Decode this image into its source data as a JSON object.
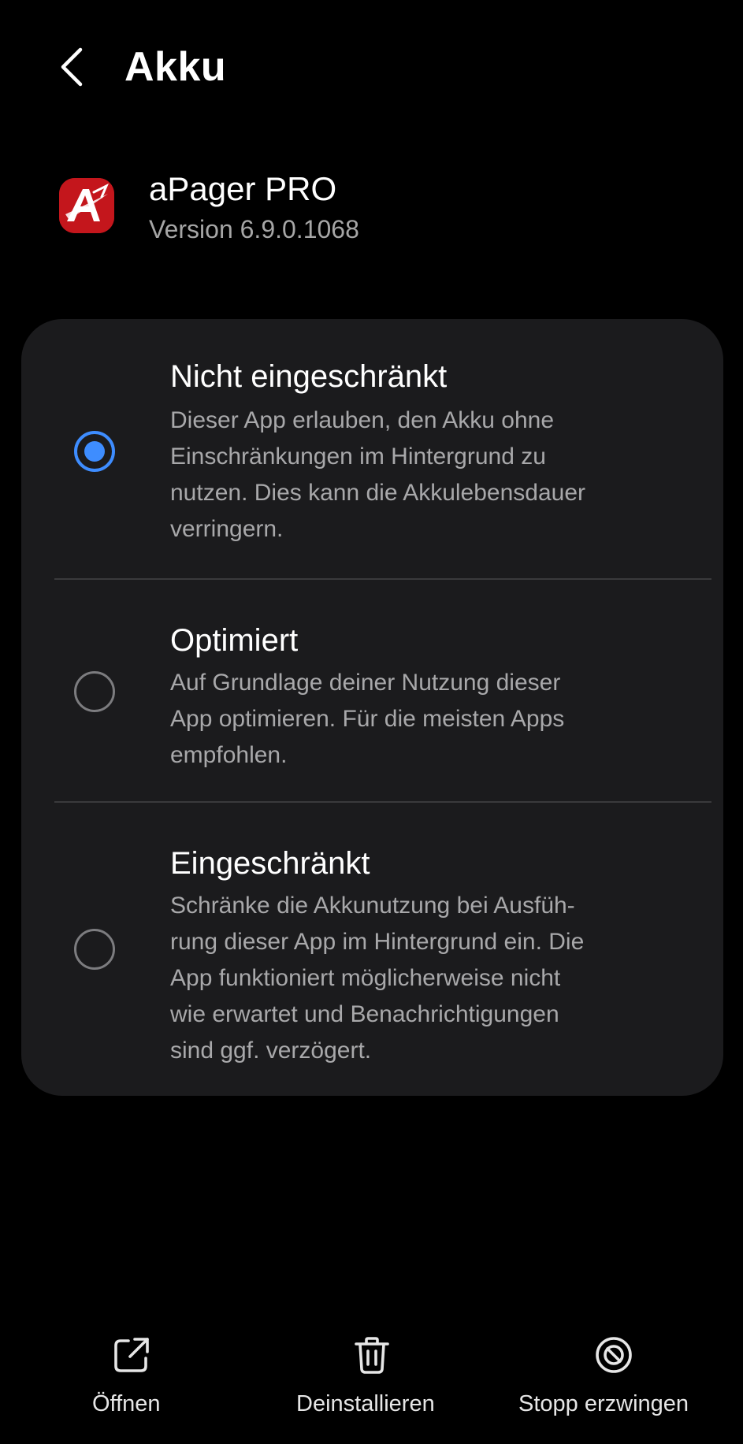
{
  "header": {
    "title": "Akku",
    "back_icon": "chevron-left-icon"
  },
  "app": {
    "name": "aPager PRO",
    "version": "Version 6.9.0.1068",
    "icon_color": "#c4161c"
  },
  "options": [
    {
      "title": "Nicht eingeschränkt",
      "desc_lines": [
        "Dieser App erlauben, den Akku ohne",
        "Einschränkungen im Hintergrund zu",
        "nutzen. Dies kann die Akkulebensdauer",
        "verringern."
      ],
      "selected": true
    },
    {
      "title": "Optimiert",
      "desc_lines": [
        "Auf Grundlage deiner Nutzung dieser",
        "App optimieren. Für die meisten Apps",
        "empfohlen."
      ],
      "selected": false
    },
    {
      "title": "Eingeschränkt",
      "desc_lines": [
        "Schränke die Akkunutzung bei Ausfüh-",
        "rung dieser App im Hintergrund ein. Die",
        "App funktioniert möglicherweise nicht",
        "wie erwartet und Benachrichtigungen",
        "sind ggf. verzögert."
      ],
      "selected": false
    }
  ],
  "bottom_actions": [
    {
      "label": "Öffnen",
      "icon": "open-external-icon"
    },
    {
      "label": "Deinstallieren",
      "icon": "trash-icon"
    },
    {
      "label": "Stopp erzwingen",
      "icon": "block-icon"
    }
  ],
  "colors": {
    "background": "#000000",
    "card": "#1b1b1d",
    "accent": "#3e8dff",
    "secondary_text": "#a8a8aa"
  }
}
